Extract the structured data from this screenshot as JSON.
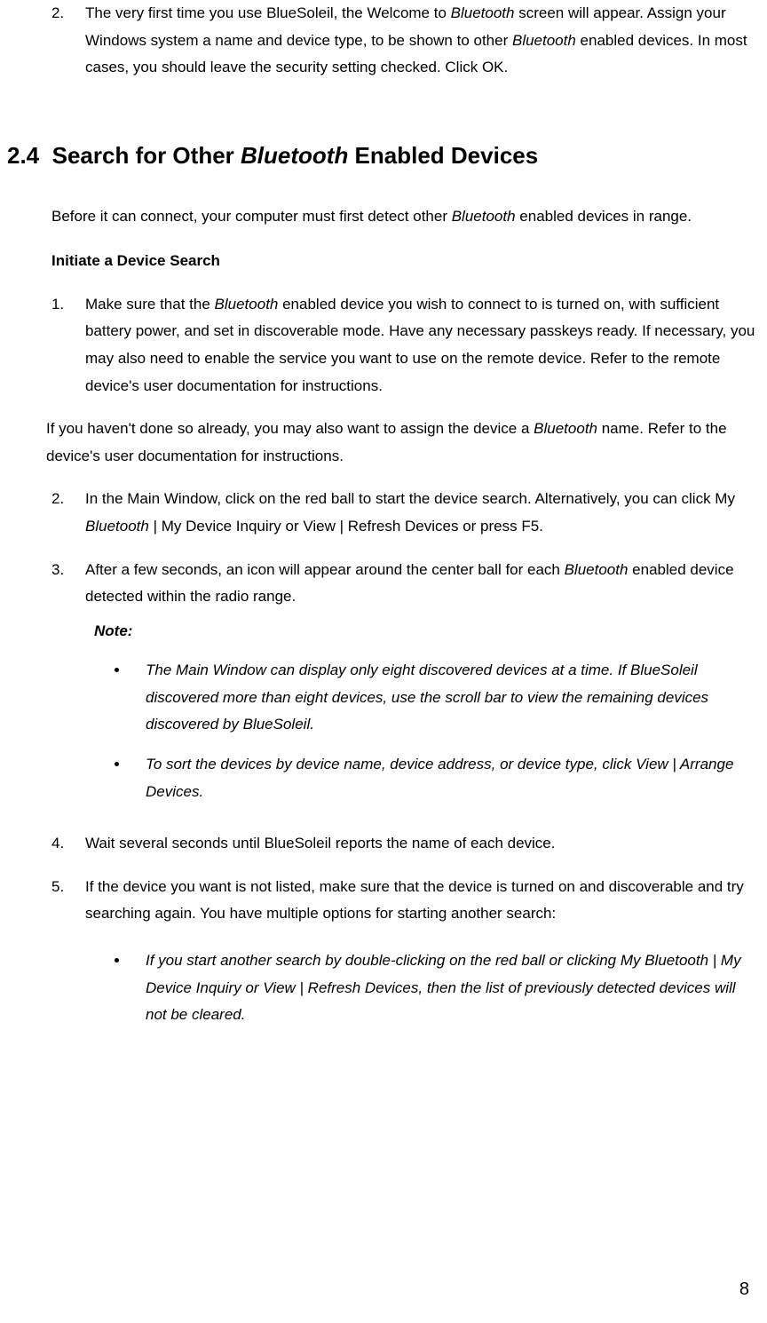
{
  "top_item": {
    "num": "2.",
    "text_parts": [
      "The very first time you use BlueSoleil, the Welcome to ",
      "Bluetooth",
      " screen will appear. Assign your Windows system a name and device type, to be shown to other ",
      "Bluetooth",
      " enabled devices. In most cases, you should leave the security setting checked. Click OK."
    ]
  },
  "heading": {
    "num": "2.4",
    "before": "Search for Other ",
    "italic": "Bluetooth",
    "after": " Enabled Devices"
  },
  "intro_parts": [
    "Before it can connect, your computer must first detect other ",
    "Bluetooth",
    " enabled devices in range."
  ],
  "subhead": "Initiate a Device Search",
  "step1": {
    "num": "1.",
    "p1_parts": [
      "Make sure that the ",
      "Bluetooth",
      " enabled device you wish to connect to is turned on, with sufficient battery power, and set in discoverable mode. Have any necessary passkeys ready. If necessary, you may also need to enable the service you want to use on the remote device. Refer to the remote device's user documentation for instructions."
    ],
    "p2_parts": [
      "If you haven't done so already, you may also want to assign the device a ",
      "Bluetooth",
      " name. Refer to the device's user documentation for instructions."
    ]
  },
  "step2": {
    "num": "2.",
    "parts": [
      "In the Main Window, click on the red ball to start the device search. Alternatively, you can click My ",
      "Bluetooth",
      " | My Device Inquiry or View | Refresh Devices or press F5."
    ]
  },
  "step3": {
    "num": "3.",
    "parts": [
      "After a few seconds, an icon will appear around the center ball for each ",
      "Bluetooth",
      " enabled device detected within the radio range."
    ],
    "note_label": "Note:",
    "bullets": [
      "The Main Window can display only eight discovered devices at a time. If BlueSoleil discovered more than eight devices, use the scroll bar to view the remaining devices discovered by BlueSoleil.",
      "To sort the devices by device name, device address, or device type, click View | Arrange Devices."
    ]
  },
  "step4": {
    "num": "4.",
    "text": "Wait several seconds until BlueSoleil reports the name of each device."
  },
  "step5": {
    "num": "5.",
    "text": "If the device you want is not listed, make sure that the device is turned on and discoverable and try searching again. You have multiple options for starting another search:",
    "bullet": "If you start another search by double-clicking on the red ball or clicking My Bluetooth | My Device Inquiry or View | Refresh Devices, then the list of previously detected devices will not be cleared."
  },
  "page_number": "8"
}
